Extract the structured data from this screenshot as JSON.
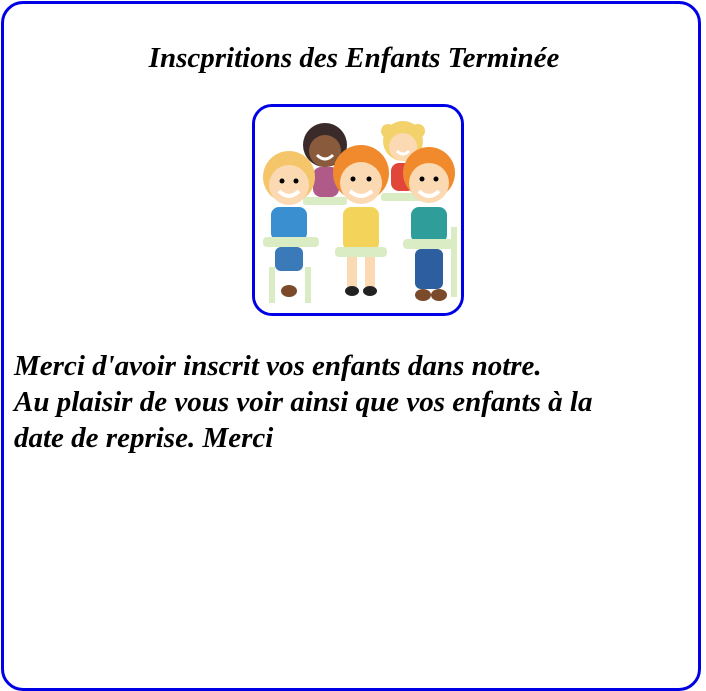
{
  "page": {
    "title": "Inscpritions des Enfants Terminée",
    "image_icon": "children-in-class-illustration",
    "message_lines": [
      "Merci d'avoir inscrit vos enfants dans notre.",
      "Au plaisir de vous voir ainsi que vos enfants à la",
      "date de reprise. Merci"
    ]
  },
  "colors": {
    "border": "#0000e6",
    "text": "#000000",
    "background": "#ffffff"
  }
}
